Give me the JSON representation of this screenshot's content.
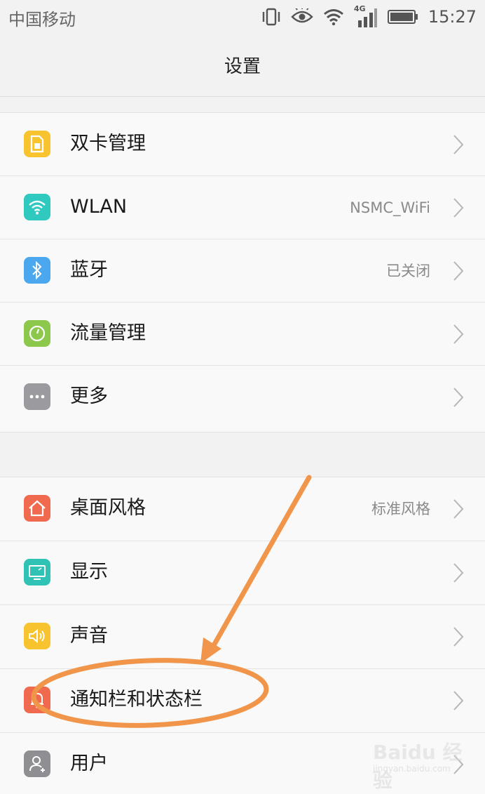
{
  "status_bar": {
    "carrier": "中国移动",
    "network": "4G",
    "time": "15:27"
  },
  "header": {
    "title": "设置"
  },
  "groups": [
    {
      "items": [
        {
          "label": "双卡管理",
          "value": "",
          "icon": "sim-card-icon",
          "color": "#f7c42f"
        },
        {
          "label": "WLAN",
          "value": "NSMC_WiFi",
          "icon": "wifi-icon",
          "color": "#2fc9c0"
        },
        {
          "label": "蓝牙",
          "value": "已关闭",
          "icon": "bluetooth-icon",
          "color": "#4ba8ee"
        },
        {
          "label": "流量管理",
          "value": "",
          "icon": "data-usage-icon",
          "color": "#8cc84b"
        },
        {
          "label": "更多",
          "value": "",
          "icon": "more-icon",
          "color": "#9a9a9f"
        }
      ]
    },
    {
      "items": [
        {
          "label": "桌面风格",
          "value": "标准风格",
          "icon": "home-icon",
          "color": "#f06a4f"
        },
        {
          "label": "显示",
          "value": "",
          "icon": "display-icon",
          "color": "#2fc2b5"
        },
        {
          "label": "声音",
          "value": "",
          "icon": "speaker-icon",
          "color": "#f7c42f"
        },
        {
          "label": "通知栏和状态栏",
          "value": "",
          "icon": "bell-icon",
          "color": "#f06a4f"
        },
        {
          "label": "用户",
          "value": "",
          "icon": "user-icon",
          "color": "#8e8e93"
        }
      ]
    }
  ],
  "watermark": {
    "main": "Baidu 经验",
    "sub": "jingyan.baidu.com"
  },
  "annotation_color": "#f0954a"
}
